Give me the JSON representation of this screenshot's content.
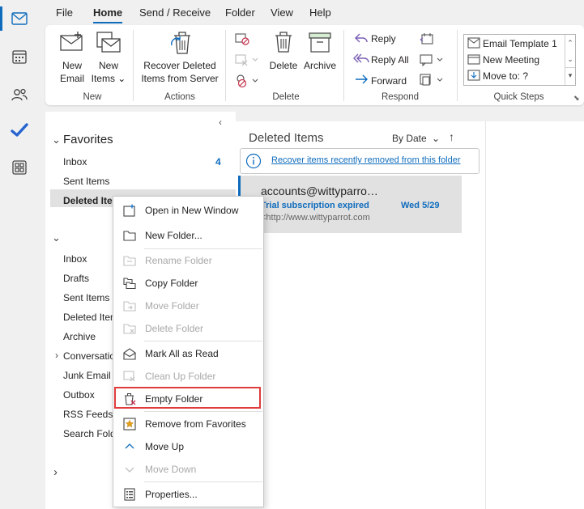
{
  "menu_tabs": [
    "File",
    "Home",
    "Send / Receive",
    "Folder",
    "View",
    "Help"
  ],
  "ribbon": {
    "new_email": [
      "New",
      "Email"
    ],
    "new_items": [
      "New",
      "Items ⌄"
    ],
    "group_new": "New",
    "recover": [
      "Recover Deleted",
      "Items from Server"
    ],
    "group_actions": "Actions",
    "delete": "Delete",
    "archive": "Archive",
    "group_delete": "Delete",
    "reply": "Reply",
    "reply_all": "Reply All",
    "forward": "Forward",
    "group_respond": "Respond",
    "quick_steps": [
      "Email Template 1",
      "New Meeting",
      "Move to: ?"
    ],
    "group_quick_steps": "Quick Steps"
  },
  "folders": {
    "favorites_header": "Favorites",
    "favorites": [
      {
        "label": "Inbox",
        "count": "4"
      },
      {
        "label": "Sent Items",
        "count": ""
      },
      {
        "label": "Deleted Ite",
        "count": ""
      }
    ],
    "account": [
      "Inbox",
      "Drafts",
      "Sent Items",
      "Deleted Iten",
      "Archive",
      "Conversatio",
      "Junk Email",
      "Outbox",
      "RSS Feeds",
      "Search Fold"
    ]
  },
  "message_list": {
    "title": "Deleted Items",
    "sort": "By Date",
    "recover_link": "Recover items recently removed from this folder",
    "messages": [
      {
        "sender": "accounts@wittyparro…",
        "subject": "Trial subscription expired",
        "date": "Wed 5/29",
        "preview": "<http://www.wittyparrot.com"
      }
    ]
  },
  "context_menu": {
    "items": [
      {
        "label": "Open in New Window",
        "disabled": false
      },
      {
        "label": "New Folder...",
        "disabled": false
      },
      {
        "label": "Rename Folder",
        "disabled": true
      },
      {
        "label": "Copy Folder",
        "disabled": false
      },
      {
        "label": "Move Folder",
        "disabled": true
      },
      {
        "label": "Delete Folder",
        "disabled": true
      },
      {
        "label": "Mark All as Read",
        "disabled": false
      },
      {
        "label": "Clean Up Folder",
        "disabled": true
      },
      {
        "label": "Empty Folder",
        "disabled": false
      },
      {
        "label": "Remove from Favorites",
        "disabled": false
      },
      {
        "label": "Move Up",
        "disabled": false
      },
      {
        "label": "Move Down",
        "disabled": true
      },
      {
        "label": "Properties...",
        "disabled": false
      }
    ],
    "highlighted_item": "Empty Folder"
  },
  "colors": {
    "accent": "#0f6cbd",
    "highlight_border": "#e03c3c",
    "link": "#0f6cbd"
  }
}
